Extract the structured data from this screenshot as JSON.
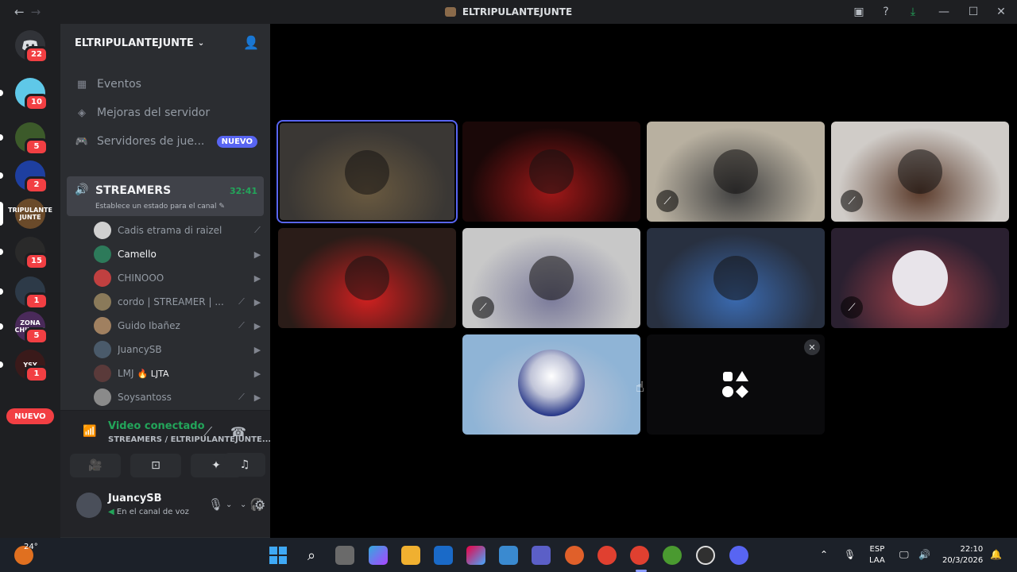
{
  "window": {
    "title": "ELTRIPULANTEJUNTE",
    "controls": [
      "minimize",
      "maximize",
      "close"
    ]
  },
  "guild_bar": {
    "home_badge": "22",
    "items": [
      {
        "badge": "10",
        "color": "#5fc8e8"
      },
      {
        "badge": "5",
        "color": "#3c5a2a"
      },
      {
        "badge": "2",
        "color": "#1e3fa0"
      },
      {
        "badge": "",
        "color": "#6a4a2a",
        "label": "TRIPULANTE JUNTE"
      },
      {
        "badge": "15",
        "color": "#2a2a2a"
      },
      {
        "badge": "1",
        "color": "#2d3a48"
      },
      {
        "badge": "5",
        "color": "#4a2a5a",
        "label": "ZONA CHILENA"
      },
      {
        "badge": "1",
        "color": "#3a1a1a",
        "label": "YSY"
      }
    ],
    "nuevo_label": "NUEVO"
  },
  "sidebar": {
    "server_name": "ELTRIPULANTEJUNTE",
    "nav": [
      {
        "label": "Eventos",
        "icon": "calendar-icon"
      },
      {
        "label": "Mejoras del servidor",
        "icon": "boost-icon"
      },
      {
        "label": "Servidores de jue...",
        "icon": "controller-icon",
        "tag": "NUEVO"
      }
    ],
    "voice_channel": {
      "name": "STREAMERS",
      "timer": "32:41",
      "status_prompt": "Establece un estado para el canal"
    },
    "members": [
      {
        "name": "Cadis etrama di raizel",
        "status": "",
        "color": "#d0d0d0"
      },
      {
        "name": "Camello",
        "status": "",
        "color": "#2d7a5a",
        "bright": true
      },
      {
        "name": "CHINOOO",
        "status": "",
        "color": "#c04040"
      },
      {
        "name": "cordo | STREAMER | ...",
        "status": "",
        "color": "#8a7a5a"
      },
      {
        "name": "Guido Ibañez",
        "status": "",
        "color": "#a08060"
      },
      {
        "name": "JuancySB",
        "status": "",
        "color": "#4a5a6a"
      },
      {
        "name": "LMJ",
        "status": "LJTA",
        "color": "#5a3a3a"
      },
      {
        "name": "Soysantoss",
        "status": "",
        "color": "#8a8a8a"
      }
    ],
    "voice_panel": {
      "connected": "Video conectado",
      "channel": "STREAMERS / ELTRIPULANTEJUNTE..."
    },
    "user": {
      "name": "JuancySB",
      "status": "En el canal de voz"
    }
  },
  "stage": {
    "tiles": [
      {
        "muted": false,
        "active": true,
        "bg": "#3a3734",
        "accent": "#6a5a40"
      },
      {
        "muted": false,
        "active": false,
        "bg": "#1a0808",
        "accent": "#a01818"
      },
      {
        "muted": true,
        "active": false,
        "bg": "#b8b0a0",
        "accent": "#404040"
      },
      {
        "muted": true,
        "active": false,
        "bg": "#d0ccc8",
        "accent": "#5a3a2a"
      },
      {
        "muted": false,
        "active": false,
        "bg": "#2a1c18",
        "accent": "#d02020"
      },
      {
        "muted": true,
        "active": false,
        "bg": "#c8c8c8",
        "accent": "#7a7a9a"
      },
      {
        "muted": false,
        "active": false,
        "bg": "#283040",
        "accent": "#3a6ab0"
      },
      {
        "muted": true,
        "active": false,
        "bg": "#2a2030",
        "accent": "#a04048"
      },
      {
        "muted": false,
        "active": false,
        "bg": "#8fb4d6",
        "accent": "#c8c8d8"
      }
    ]
  },
  "taskbar": {
    "weather": "24°",
    "lang_top": "ESP",
    "lang_bottom": "LAA",
    "time": "22:10",
    "date": "20/3/2026"
  }
}
